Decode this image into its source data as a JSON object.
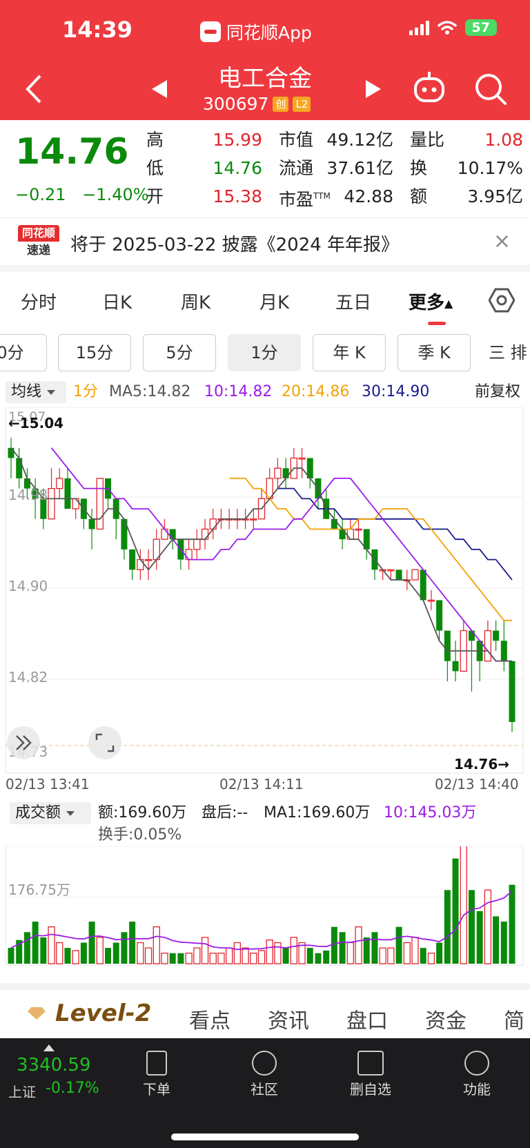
{
  "status_bar": {
    "time": "14:39",
    "app": "同花顺App",
    "battery": "57"
  },
  "header": {
    "title": "电工合金",
    "code": "300697",
    "tag1": "创",
    "tag2": "L2"
  },
  "quote": {
    "price": "14.76",
    "change": "−0.21",
    "change_pct": "−1.40%",
    "high_label": "高",
    "high": "15.99",
    "low_label": "低",
    "low": "14.76",
    "open_label": "开",
    "open": "15.38",
    "mcap_label": "市值",
    "mcap": "49.12亿",
    "float_label": "流通",
    "float": "37.61亿",
    "pe_label": "市盈",
    "pe_sup": "TTM",
    "pe": "42.88",
    "vr_label": "量比",
    "vr": "1.08",
    "turn_label": "换",
    "turn": "10.17%",
    "amt_label": "额",
    "amt": "3.95亿"
  },
  "notice": {
    "logo_top": "同花顺",
    "logo_bottom": "速递",
    "text": "将于 2025-03-22 披露《2024 年年报》",
    "close": "×"
  },
  "tabs": [
    "分时",
    "日K",
    "周K",
    "月K",
    "五日",
    "更多"
  ],
  "chips": [
    "0分",
    "15分",
    "5分",
    "1分",
    "年 K",
    "季 K",
    "三 排"
  ],
  "ma": {
    "selector": "均线",
    "period": "1分",
    "ma5": "MA5:14.82",
    "ma10": "10:14.82",
    "ma20": "20:14.86",
    "ma30": "30:14.90",
    "adjust": "前复权"
  },
  "chart_labels": {
    "y_top": "15.07",
    "max_label": "←15.04",
    "y1": "14.98",
    "y2": "14.90",
    "y3": "14.82",
    "y_bottom": "14.73",
    "last_label": "14.76→",
    "x1": "02/13 13:41",
    "x2": "02/13 14:11",
    "x3": "02/13 14:40"
  },
  "volume": {
    "selector": "成交额",
    "amount": "额:169.60万",
    "after": "盘后:--",
    "ma1": "MA1:169.60万",
    "ma10": "10:145.03万",
    "turnover": "换手:0.05%",
    "level": "176.75万"
  },
  "subtabs": [
    "Level-2",
    "看点",
    "资讯",
    "盘口",
    "资金",
    "简"
  ],
  "bottom": {
    "index": "3340.59",
    "index_name": "上证",
    "index_chg": "-0.17%",
    "items": [
      "下单",
      "社区",
      "删自选",
      "功能"
    ]
  },
  "colors": {
    "up": "#e3232b",
    "down": "#0a8a0a",
    "ma5": "#555555",
    "ma10": "#9b1be8",
    "ma20": "#f2a200",
    "ma30": "#1a1a8c"
  },
  "chart_data": {
    "type": "candlestick",
    "ylim": [
      14.73,
      15.07
    ],
    "candles": [
      [
        15.03,
        15.02,
        15.04,
        15.0
      ],
      [
        15.02,
        15.0,
        15.03,
        14.99
      ],
      [
        15.0,
        14.99,
        15.01,
        14.98
      ],
      [
        14.99,
        14.98,
        15.0,
        14.96
      ],
      [
        14.98,
        14.96,
        14.99,
        14.95
      ],
      [
        14.96,
        14.99,
        15.01,
        14.96
      ],
      [
        14.99,
        15.0,
        15.01,
        14.98
      ],
      [
        15.0,
        14.97,
        15.01,
        14.97
      ],
      [
        14.97,
        14.98,
        14.98,
        14.96
      ],
      [
        14.98,
        14.96,
        14.98,
        14.95
      ],
      [
        14.96,
        14.95,
        14.97,
        14.93
      ],
      [
        14.95,
        15.0,
        15.0,
        14.95
      ],
      [
        15.0,
        14.98,
        15.0,
        14.97
      ],
      [
        14.98,
        14.96,
        14.98,
        14.94
      ],
      [
        14.96,
        14.93,
        14.96,
        14.92
      ],
      [
        14.93,
        14.91,
        14.93,
        14.9
      ],
      [
        14.91,
        14.92,
        14.93,
        14.9
      ],
      [
        14.92,
        14.92,
        14.93,
        14.9
      ],
      [
        14.92,
        14.94,
        14.95,
        14.91
      ],
      [
        14.94,
        14.95,
        14.96,
        14.94
      ],
      [
        14.95,
        14.94,
        14.95,
        14.93
      ],
      [
        14.94,
        14.92,
        14.94,
        14.91
      ],
      [
        14.92,
        14.93,
        14.94,
        14.91
      ],
      [
        14.93,
        14.94,
        14.95,
        14.92
      ],
      [
        14.94,
        14.95,
        14.96,
        14.93
      ],
      [
        14.95,
        14.96,
        14.97,
        14.94
      ],
      [
        14.96,
        14.96,
        14.97,
        14.95
      ],
      [
        14.96,
        14.96,
        14.97,
        14.95
      ],
      [
        14.96,
        14.96,
        14.97,
        14.95
      ],
      [
        14.96,
        14.96,
        14.97,
        14.95
      ],
      [
        14.96,
        14.96,
        14.97,
        14.95
      ],
      [
        14.96,
        14.98,
        14.99,
        14.96
      ],
      [
        14.98,
        15.0,
        15.01,
        14.98
      ],
      [
        15.0,
        15.01,
        15.02,
        14.99
      ],
      [
        15.01,
        15.0,
        15.02,
        14.99
      ],
      [
        15.0,
        15.02,
        15.03,
        15.0
      ],
      [
        15.02,
        15.02,
        15.03,
        15.0
      ],
      [
        15.02,
        15.0,
        15.02,
        14.99
      ],
      [
        15.0,
        14.98,
        15.0,
        14.97
      ],
      [
        14.98,
        14.96,
        14.99,
        14.96
      ],
      [
        14.96,
        14.95,
        14.97,
        14.95
      ],
      [
        14.95,
        14.94,
        14.96,
        14.93
      ],
      [
        14.94,
        14.95,
        14.96,
        14.94
      ],
      [
        14.95,
        14.95,
        14.96,
        14.94
      ],
      [
        14.95,
        14.93,
        14.95,
        14.92
      ],
      [
        14.93,
        14.91,
        14.93,
        14.9
      ],
      [
        14.91,
        14.91,
        14.91,
        14.9
      ],
      [
        14.91,
        14.91,
        14.91,
        14.9
      ],
      [
        14.91,
        14.9,
        14.91,
        14.9
      ],
      [
        14.9,
        14.9,
        14.91,
        14.89
      ],
      [
        14.9,
        14.91,
        14.91,
        14.9
      ],
      [
        14.91,
        14.88,
        14.91,
        14.88
      ],
      [
        14.88,
        14.88,
        14.89,
        14.87
      ],
      [
        14.88,
        14.85,
        14.88,
        14.84
      ],
      [
        14.85,
        14.82,
        14.85,
        14.8
      ],
      [
        14.82,
        14.81,
        14.84,
        14.8
      ],
      [
        14.81,
        14.85,
        14.86,
        14.81
      ],
      [
        14.85,
        14.84,
        14.85,
        14.79
      ],
      [
        14.84,
        14.82,
        14.84,
        14.8
      ],
      [
        14.82,
        14.85,
        14.86,
        14.82
      ],
      [
        14.85,
        14.84,
        14.86,
        14.83
      ],
      [
        14.84,
        14.82,
        14.86,
        14.81
      ],
      [
        14.82,
        14.76,
        14.82,
        14.75
      ]
    ],
    "ma5": [
      15.03,
      15.02,
      15.0,
      14.99,
      14.98,
      14.98,
      14.98,
      14.98,
      14.98,
      14.97,
      14.96,
      14.96,
      14.97,
      14.97,
      14.96,
      14.94,
      14.92,
      14.91,
      14.92,
      14.93,
      14.94,
      14.94,
      14.94,
      14.94,
      14.94,
      14.95,
      14.96,
      14.96,
      14.96,
      14.96,
      14.97,
      14.97,
      14.98,
      14.99,
      15.0,
      15.01,
      15.01,
      15.0,
      14.99,
      14.97,
      14.96,
      14.95,
      14.94,
      14.94,
      14.93,
      14.92,
      14.91,
      14.9,
      14.9,
      14.9,
      14.89,
      14.88,
      14.86,
      14.84,
      14.83,
      14.83,
      14.83,
      14.83,
      14.83,
      14.83,
      14.82,
      14.82,
      14.82
    ],
    "ma10": [
      15.03,
      15.02,
      15.01,
      15.0,
      14.99,
      14.99,
      14.99,
      14.99,
      14.98,
      14.98,
      14.97,
      14.97,
      14.97,
      14.96,
      14.95,
      14.94,
      14.93,
      14.92,
      14.92,
      14.92,
      14.92,
      14.93,
      14.93,
      14.94,
      14.94,
      14.95,
      14.95,
      14.95,
      14.95,
      14.95,
      14.96,
      14.96,
      14.97,
      14.98,
      14.99,
      15.0,
      15.0,
      15.0,
      14.99,
      14.98,
      14.97,
      14.96,
      14.95,
      14.94,
      14.93,
      14.92,
      14.91,
      14.9,
      14.89,
      14.88,
      14.87,
      14.86,
      14.85,
      14.84,
      14.83,
      14.82,
      14.82,
      14.82
    ],
    "ma20": [
      15.0,
      15.0,
      15.0,
      14.99,
      14.99,
      14.98,
      14.97,
      14.97,
      14.96,
      14.96,
      14.95,
      14.95,
      14.95,
      14.95,
      14.95,
      14.95,
      14.96,
      14.96,
      14.96,
      14.97,
      14.97,
      14.97,
      14.97,
      14.96,
      14.96,
      14.95,
      14.94,
      14.93,
      14.92,
      14.91,
      14.9,
      14.89,
      14.88,
      14.87,
      14.86,
      14.86
    ],
    "ma30": [
      14.99,
      14.99,
      14.99,
      14.98,
      14.98,
      14.97,
      14.97,
      14.97,
      14.96,
      14.96,
      14.96,
      14.96,
      14.96,
      14.96,
      14.96,
      14.96,
      14.96,
      14.96,
      14.95,
      14.95,
      14.95,
      14.95,
      14.94,
      14.94,
      14.93,
      14.93,
      14.92,
      14.92,
      14.91,
      14.9
    ],
    "volumes": [
      30,
      45,
      60,
      80,
      50,
      70,
      40,
      30,
      25,
      40,
      80,
      50,
      30,
      40,
      60,
      80,
      40,
      30,
      70,
      20,
      20,
      20,
      20,
      30,
      50,
      20,
      20,
      30,
      40,
      30,
      20,
      25,
      45,
      40,
      30,
      50,
      40,
      30,
      20,
      25,
      70,
      60,
      40,
      70,
      50,
      60,
      30,
      30,
      70,
      40,
      50,
      30,
      20,
      40,
      140,
      200,
      300,
      140,
      100,
      140,
      90,
      80,
      150
    ]
  }
}
